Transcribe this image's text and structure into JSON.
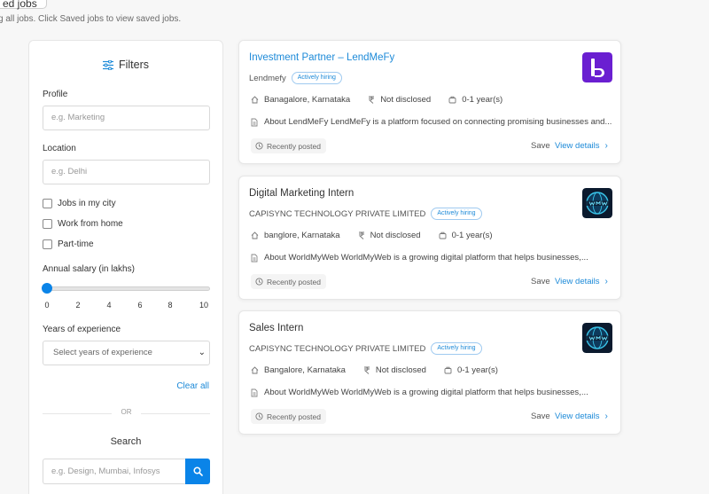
{
  "header": {
    "saved_jobs_label": "ed jobs",
    "note": "g all jobs. Click Saved jobs to view saved jobs."
  },
  "filters": {
    "title": "Filters",
    "profile": {
      "label": "Profile",
      "placeholder": "e.g. Marketing"
    },
    "location": {
      "label": "Location",
      "placeholder": "e.g. Delhi"
    },
    "checkboxes": [
      {
        "label": "Jobs in my city",
        "checked": false
      },
      {
        "label": "Work from home",
        "checked": false
      },
      {
        "label": "Part-time",
        "checked": false
      }
    ],
    "salary": {
      "label": "Annual salary (in lakhs)",
      "ticks": [
        "0",
        "2",
        "4",
        "6",
        "8",
        "10"
      ],
      "value": 0
    },
    "experience": {
      "label": "Years of experience",
      "placeholder": "Select years of experience"
    },
    "clear_all": "Clear all",
    "or": "OR",
    "search": {
      "title": "Search",
      "placeholder": "e.g. Design, Mumbai, Infosys"
    }
  },
  "jobs": [
    {
      "title": "Investment Partner – LendMeFy",
      "company": "Lendmefy",
      "badge": "Actively hiring",
      "location": "Banagalore, Karnataka",
      "stipend": "Not disclosed",
      "experience": "0-1 year(s)",
      "about": "About LendMeFy LendMeFy is a platform focused on connecting promising businesses and...",
      "posted": "Recently posted",
      "save": "Save",
      "view": "View details"
    },
    {
      "title": "Digital Marketing Intern",
      "company": "CAPISYNC TECHNOLOGY PRIVATE LIMITED",
      "badge": "Actively hiring",
      "location": "banglore, Karnataka",
      "stipend": "Not disclosed",
      "experience": "0-1 year(s)",
      "about": "About WorldMyWeb WorldMyWeb is a growing digital platform that helps businesses,...",
      "posted": "Recently posted",
      "save": "Save",
      "view": "View details"
    },
    {
      "title": "Sales Intern",
      "company": "CAPISYNC TECHNOLOGY PRIVATE LIMITED",
      "badge": "Actively hiring",
      "location": "Bangalore, Karnataka",
      "stipend": "Not disclosed",
      "experience": "0-1 year(s)",
      "about": "About WorldMyWeb WorldMyWeb is a growing digital platform that helps businesses,...",
      "posted": "Recently posted",
      "save": "Save",
      "view": "View details"
    }
  ],
  "colors": {
    "accent": "#1d8ad8",
    "slider": "#0a84e8",
    "lendmefy_logo": "#6a1fd1",
    "worldmyweb_logo": "#0b1a2e"
  }
}
